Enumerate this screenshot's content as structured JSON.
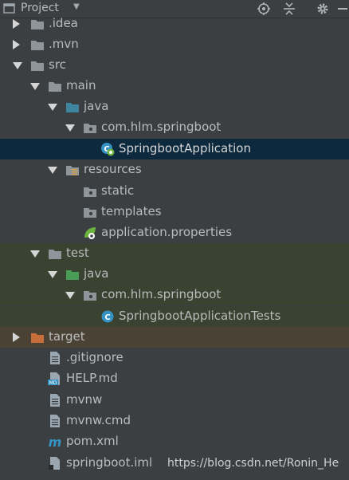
{
  "header": {
    "title": "Project",
    "icons": [
      "target-icon",
      "collapse-icon",
      "gear-icon",
      "hide-icon"
    ]
  },
  "tree": [
    {
      "label": ".idea",
      "icon": "folder",
      "state": "collapsed"
    },
    {
      "label": ".mvn",
      "icon": "folder",
      "state": "collapsed"
    },
    {
      "label": "src",
      "icon": "folder",
      "state": "expanded"
    },
    {
      "label": "main",
      "icon": "folder",
      "state": "expanded"
    },
    {
      "label": "java",
      "icon": "source-folder",
      "state": "expanded"
    },
    {
      "label": "com.hlm.springboot",
      "icon": "package",
      "state": "expanded"
    },
    {
      "label": "SpringbootApplication",
      "icon": "spring-class",
      "state": "leaf",
      "selected": true
    },
    {
      "label": "resources",
      "icon": "resources-folder",
      "state": "expanded"
    },
    {
      "label": "static",
      "icon": "package",
      "state": "leaf"
    },
    {
      "label": "templates",
      "icon": "package",
      "state": "leaf"
    },
    {
      "label": "application.properties",
      "icon": "spring-properties",
      "state": "leaf"
    },
    {
      "label": "test",
      "icon": "folder",
      "state": "expanded"
    },
    {
      "label": "java",
      "icon": "test-folder",
      "state": "expanded"
    },
    {
      "label": "com.hlm.springboot",
      "icon": "package",
      "state": "expanded"
    },
    {
      "label": "SpringbootApplicationTests",
      "icon": "class",
      "state": "leaf"
    },
    {
      "label": "target",
      "icon": "excluded-folder",
      "state": "collapsed"
    },
    {
      "label": ".gitignore",
      "icon": "text-file",
      "state": "leaf"
    },
    {
      "label": "HELP.md",
      "icon": "md-file",
      "state": "leaf"
    },
    {
      "label": "mvnw",
      "icon": "text-file",
      "state": "leaf"
    },
    {
      "label": "mvnw.cmd",
      "icon": "text-file",
      "state": "leaf"
    },
    {
      "label": "pom.xml",
      "icon": "maven-file",
      "state": "leaf"
    },
    {
      "label": "springboot.iml",
      "icon": "iml-file",
      "state": "leaf"
    }
  ],
  "watermark": "https://blog.csdn.net/Ronin_He",
  "colors": {
    "background": "#3c3f41",
    "selected": "#0d293e",
    "test_bg": "#3a4232",
    "excluded_bg": "#4a4234",
    "folder": "#8f969b",
    "source_folder": "#3e86a0",
    "test_folder": "#499c54",
    "excluded_folder": "#c76e3b"
  }
}
